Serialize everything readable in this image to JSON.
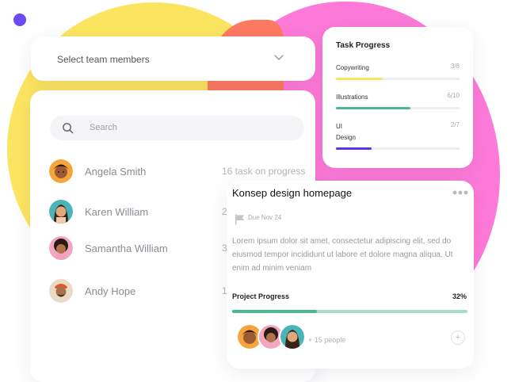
{
  "select": {
    "label": "Select team members",
    "icon": "chevron-down-icon"
  },
  "search": {
    "placeholder": "Search",
    "icon": "search-icon"
  },
  "members": [
    {
      "name": "Angela Smith",
      "info": "16 task on progress"
    },
    {
      "name": "Karen William",
      "info": "2"
    },
    {
      "name": "Samantha William",
      "info": "3"
    },
    {
      "name": "Andy Hope",
      "info": "1"
    }
  ],
  "task_progress": {
    "title": "Task Progress",
    "tasks": [
      {
        "label": "Copywriting",
        "count": "3/8",
        "color": "#fbe560",
        "fraction": 0.375
      },
      {
        "label": "Illustrations",
        "count": "6/10",
        "color": "#4cb88f",
        "fraction": 0.6
      },
      {
        "label": "UI\nDesign",
        "count": "2/7",
        "color": "#5b35e6",
        "fraction": 0.29
      }
    ]
  },
  "project": {
    "title": "Konsep design homepage",
    "due": "Due Nov 24",
    "description": "Lorem ipsum dolor sit amet, consectetur adipiscing elit, sed do eiusmod tempor incididunt ut labore et dolore magna aliqua. Ut enim ad minim veniam",
    "progress_label": "Project Progress",
    "progress_pct": "32%",
    "progress_fraction": 0.36,
    "people": "+ 15 people",
    "add_label": "+"
  },
  "colors": {
    "accent": "#6c4af2",
    "yellow": "#fbe560",
    "pink": "#fd7ad8",
    "green": "#4cb88f"
  }
}
